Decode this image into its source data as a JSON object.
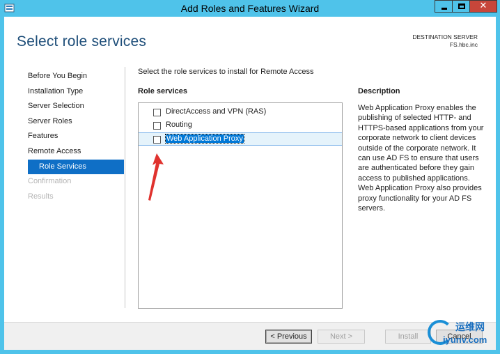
{
  "window": {
    "title": "Add Roles and Features Wizard",
    "close_glyph": "✕"
  },
  "page": {
    "heading": "Select role services",
    "destination_label": "DESTINATION SERVER",
    "destination_value": "FS.hbc.inc",
    "instruction": "Select the role services to install for Remote Access"
  },
  "nav": {
    "items": [
      {
        "label": "Before You Begin",
        "state": "normal"
      },
      {
        "label": "Installation Type",
        "state": "normal"
      },
      {
        "label": "Server Selection",
        "state": "normal"
      },
      {
        "label": "Server Roles",
        "state": "normal"
      },
      {
        "label": "Features",
        "state": "normal"
      },
      {
        "label": "Remote Access",
        "state": "normal"
      },
      {
        "label": "Role Services",
        "state": "selected"
      },
      {
        "label": "Confirmation",
        "state": "disabled"
      },
      {
        "label": "Results",
        "state": "disabled"
      }
    ]
  },
  "role_services": {
    "header": "Role services",
    "items": [
      {
        "label": "DirectAccess and VPN (RAS)",
        "checked": false,
        "selected": false
      },
      {
        "label": "Routing",
        "checked": false,
        "selected": false
      },
      {
        "label": "Web Application Proxy",
        "checked": false,
        "selected": true
      }
    ]
  },
  "description": {
    "header": "Description",
    "text": "Web Application Proxy enables the publishing of selected HTTP- and HTTPS-based applications from your corporate network to client devices outside of the corporate network. It can use AD FS to ensure that users are authenticated before they gain access to published applications. Web Application Proxy also provides proxy functionality for your AD FS servers."
  },
  "footer": {
    "previous": "< Previous",
    "next": "Next >",
    "install": "Install",
    "cancel": "Cancel"
  },
  "watermark": {
    "top": "运维网",
    "bottom": "iyunv.com"
  },
  "colors": {
    "titlebar": "#4fc3ea",
    "accent": "#0f6fc6",
    "heading": "#1e4e79",
    "arrow": "#e0322e"
  }
}
